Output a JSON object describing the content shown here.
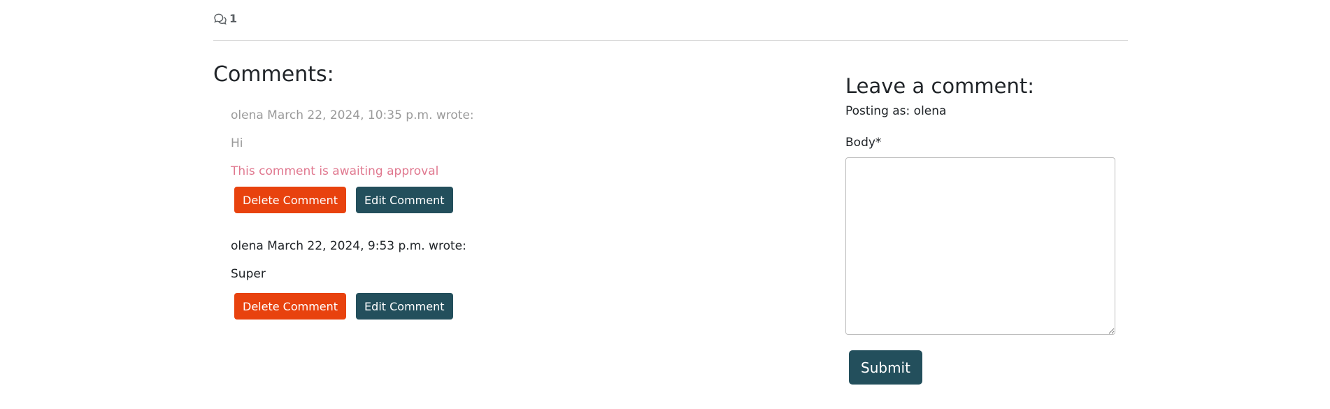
{
  "stats": {
    "comment_count": "1"
  },
  "comments_section": {
    "title": "Comments:",
    "comments": [
      {
        "meta": "olena March 22, 2024, 10:35 p.m. wrote:",
        "body": "Hi",
        "pending_note": "This comment is awaiting approval",
        "delete_label": "Delete Comment",
        "edit_label": "Edit Comment"
      },
      {
        "meta": "olena March 22, 2024, 9:53 p.m. wrote:",
        "body": "Super",
        "delete_label": "Delete Comment",
        "edit_label": "Edit Comment"
      }
    ]
  },
  "comment_form": {
    "title": "Leave a comment:",
    "posting_as": "Posting as: olena",
    "body_label": "Body*",
    "body_value": "",
    "submit_label": "Submit"
  },
  "colors": {
    "primary_dark": "#234f5c",
    "delete_accent": "#e8420e",
    "pending_note": "#e0788f",
    "muted_text": "#9a9a9a"
  }
}
